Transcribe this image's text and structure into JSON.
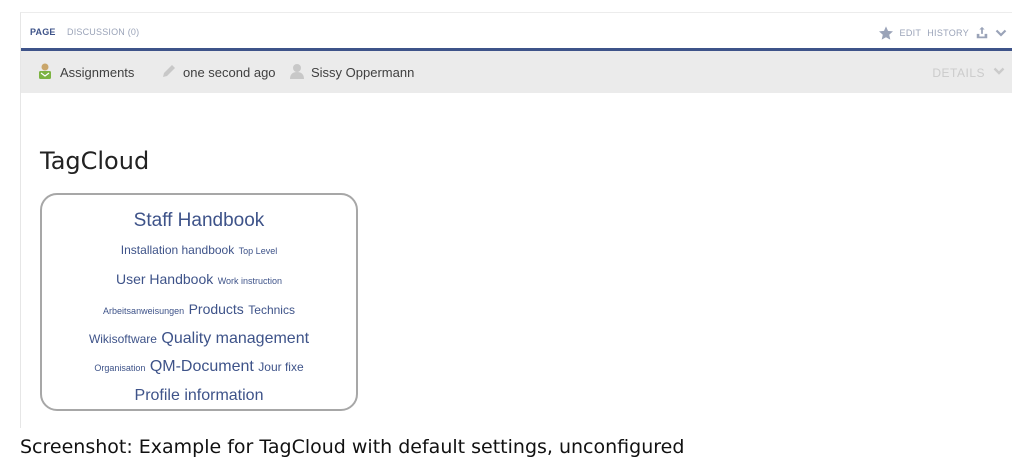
{
  "tabs": {
    "page": "PAGE",
    "discussion": "DISCUSSION (0)"
  },
  "actions": {
    "edit": "EDIT",
    "history": "HISTORY"
  },
  "infobar": {
    "category": "Assignments",
    "modified": "one second ago",
    "author": "Sissy Oppermann",
    "details": "DETAILS"
  },
  "page": {
    "title": "TagCloud"
  },
  "tagcloud": {
    "lines": [
      [
        {
          "text": "Staff Handbook",
          "size": "xl"
        }
      ],
      [
        {
          "text": "Installation handbook",
          "size": "s"
        },
        {
          "text": "Top Level",
          "size": "xs"
        }
      ],
      [
        {
          "text": "User Handbook",
          "size": "m"
        },
        {
          "text": "Work instruction",
          "size": "xs"
        }
      ],
      [
        {
          "text": "Arbeitsanweisungen",
          "size": "xs"
        },
        {
          "text": "Products",
          "size": "m"
        },
        {
          "text": "Technics",
          "size": "s"
        }
      ],
      [
        {
          "text": "Wikisoftware",
          "size": "s"
        },
        {
          "text": "Quality management",
          "size": "l"
        }
      ],
      [
        {
          "text": "Organisation",
          "size": "xs"
        },
        {
          "text": "QM-Document",
          "size": "l"
        },
        {
          "text": "Jour fixe",
          "size": "s"
        }
      ],
      [
        {
          "text": "Profile information",
          "size": "l"
        }
      ]
    ]
  },
  "caption": "Screenshot: Example for TagCloud with default settings, unconfigured",
  "colors": {
    "accent": "#3e5389",
    "muted": "#9aa3b8",
    "infobar_bg": "#ebebeb",
    "user_icon": "#c8c8c8",
    "category_icon": "#7cb342"
  }
}
